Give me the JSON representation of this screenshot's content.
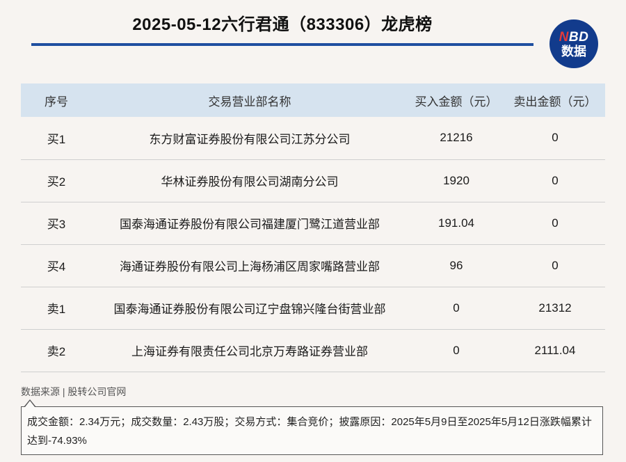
{
  "title": "2025-05-12六行君通（833306）龙虎榜",
  "logo": {
    "line1_n": "N",
    "line1_rest": "BD",
    "line2": "数据"
  },
  "table": {
    "headers": [
      "序号",
      "交易营业部名称",
      "买入金额（元）",
      "卖出金额（元）"
    ],
    "rows": [
      [
        "买1",
        "东方财富证券股份有限公司江苏分公司",
        "21216",
        "0"
      ],
      [
        "买2",
        "华林证券股份有限公司湖南分公司",
        "1920",
        "0"
      ],
      [
        "买3",
        "国泰海通证券股份有限公司福建厦门鹭江道营业部",
        "191.04",
        "0"
      ],
      [
        "买4",
        "海通证券股份有限公司上海杨浦区周家嘴路营业部",
        "96",
        "0"
      ],
      [
        "卖1",
        "国泰海通证券股份有限公司辽宁盘锦兴隆台街营业部",
        "0",
        "21312"
      ],
      [
        "卖2",
        "上海证券有限责任公司北京万寿路证券营业部",
        "0",
        "2111.04"
      ]
    ]
  },
  "source": "数据来源 | 股转公司官网",
  "note": "成交金额：2.34万元；成交数量：2.43万股；交易方式：集合竞价；披露原因：2025年5月9日至2025年5月12日涨跌幅累计达到-74.93%",
  "colors": {
    "accent": "#1f4fa0",
    "header_bg": "#d6e3ef",
    "logo_bg": "#123b8c",
    "logo_n": "#e23a3a"
  }
}
